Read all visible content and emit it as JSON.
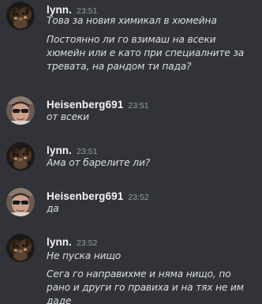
{
  "messages": [
    {
      "author": "lynn.",
      "time": "23:51",
      "lines": [
        "Това за новия химикал в хюмейна",
        "Постоянно ли го взимаш на всеки хюмейн или е като при специалните за тревата, на рандом ти пада?"
      ]
    },
    {
      "author": "Heisenberg691",
      "time": "23:51",
      "lines": [
        "от всеки"
      ]
    },
    {
      "author": "lynn.",
      "time": "23:51",
      "lines": [
        "Ама от барелите ли?"
      ]
    },
    {
      "author": "Heisenberg691",
      "time": "23:52",
      "lines": [
        "да"
      ]
    },
    {
      "author": "lynn.",
      "time": "23:52",
      "lines": [
        "Не пуска нищо",
        "Сега го направихме и няма нищо, по рано и други го правиха и на тях не им даде"
      ]
    }
  ],
  "colors": {
    "background": "#313338",
    "username": "#f2f3f5",
    "timestamp": "#949ba4",
    "text": "#dbdee1"
  },
  "icons": {
    "lynn_avatar": "dogs-avatar-icon",
    "heisenberg_avatar": "man-sunglasses-avatar-icon"
  }
}
